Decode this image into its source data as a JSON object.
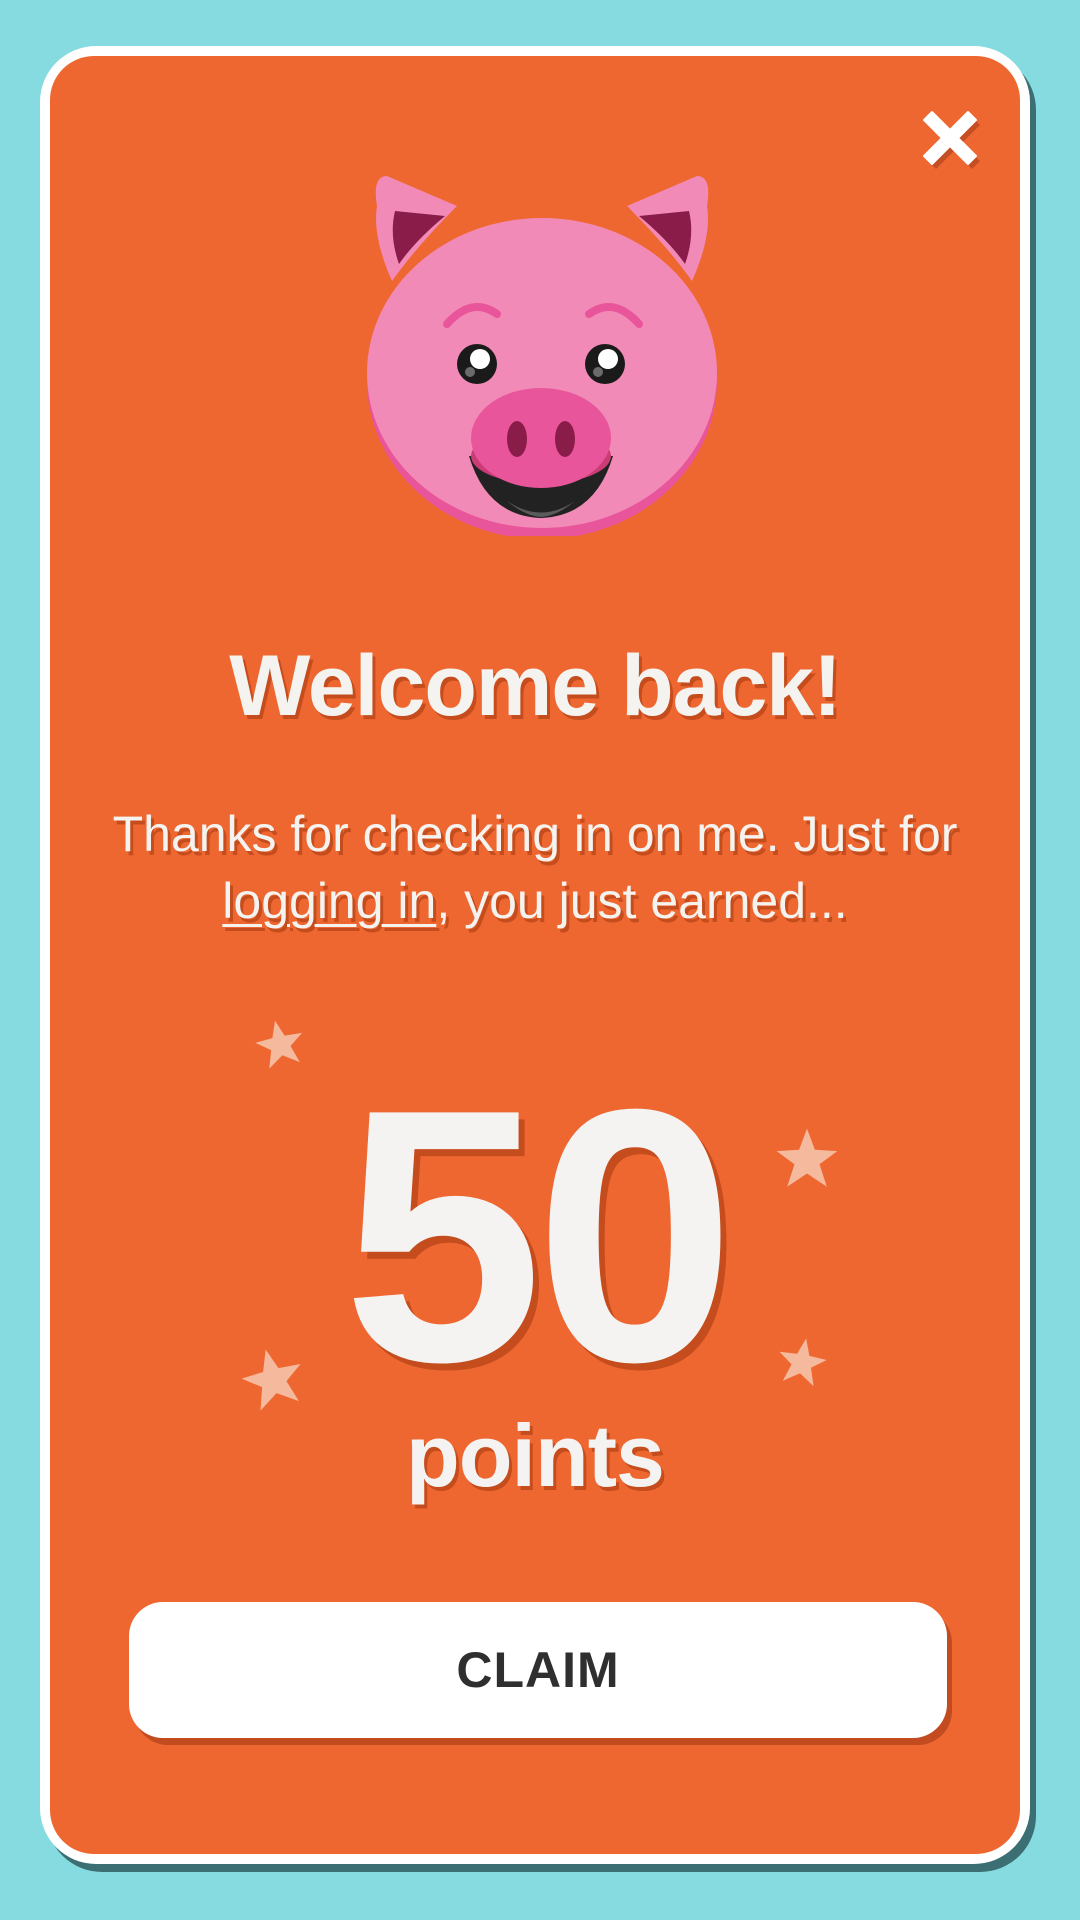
{
  "dialog": {
    "title": "Welcome back!",
    "message_before_link": "Thanks for checking in on me. Just for ",
    "message_link": "logging in",
    "message_after_link": ", you just earned...",
    "reward_amount": "50",
    "reward_unit": "points",
    "claim_label": "CLAIM"
  },
  "icons": {
    "close": "close-icon",
    "mascot": "pig-mascot-icon",
    "star": "star-icon"
  },
  "colors": {
    "page_background": "#86dbe0",
    "card_background": "#ef6730",
    "card_border": "#ffffff",
    "text": "#f5f3ef",
    "button_background": "#ffffff",
    "button_text": "#2f2f2f",
    "pig_face": "#f28ab7",
    "pig_snout": "#e94c8a",
    "star": "#f5b99d"
  }
}
